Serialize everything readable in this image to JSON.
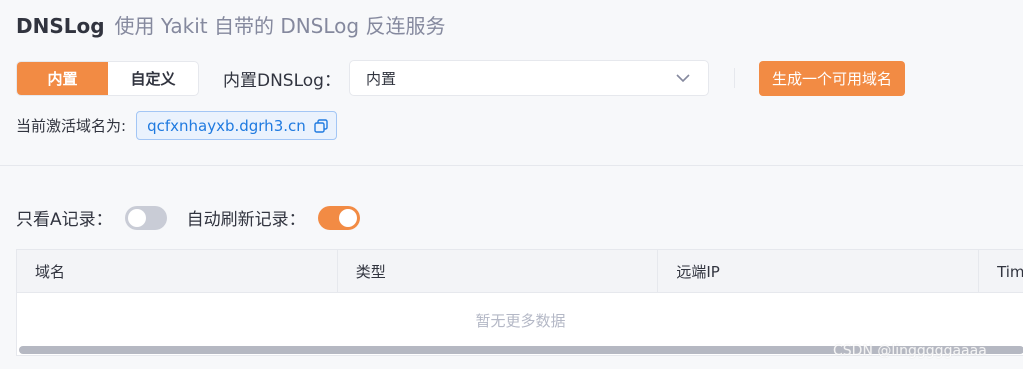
{
  "header": {
    "title": "DNSLog",
    "subtitle": "使用 Yakit 自带的 DNSLog 反连服务"
  },
  "mode": {
    "options": [
      "内置",
      "自定义"
    ],
    "selected": "内置"
  },
  "builtin_select": {
    "label": "内置DNSLog：",
    "value": "内置"
  },
  "generate_button": "生成一个可用域名",
  "active_domain": {
    "label": "当前激活域名为:",
    "value": "qcfxnhayxb.dgrh3.cn"
  },
  "toggles": {
    "a_record_only": {
      "label": "只看A记录：",
      "on": false
    },
    "auto_refresh": {
      "label": "自动刷新记录：",
      "on": true
    }
  },
  "table": {
    "columns": [
      "域名",
      "类型",
      "远端IP",
      "Tim"
    ],
    "empty_text": "暂无更多数据"
  },
  "watermark": "CSDN @lingggggaaaa",
  "colors": {
    "accent": "#f28b44",
    "link": "#1f7ae0",
    "toggle_off": "#c9ccd6"
  }
}
